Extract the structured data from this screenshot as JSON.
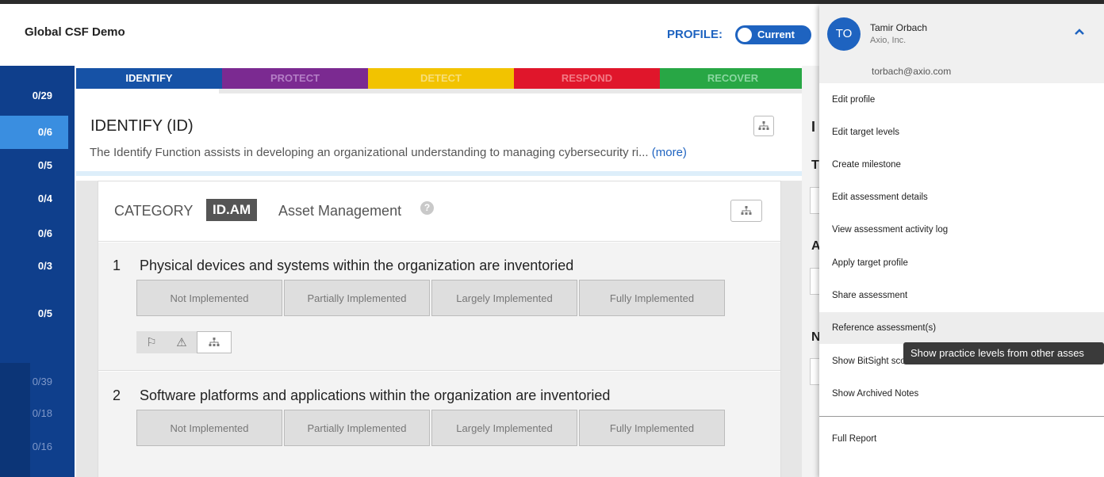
{
  "app": {
    "title": "Global CSF Demo"
  },
  "profile": {
    "label": "PROFILE:",
    "toggle": "Current"
  },
  "tabs": [
    {
      "label": "IDENTIFY",
      "color": "#1652a6"
    },
    {
      "label": "PROTECT",
      "color": "#7b2a91"
    },
    {
      "label": "DETECT",
      "color": "#f2c300"
    },
    {
      "label": "RESPOND",
      "color": "#e0162b"
    },
    {
      "label": "RECOVER",
      "color": "#28a745"
    }
  ],
  "sidebar": {
    "items": [
      "0/29",
      "0/6",
      "0/5",
      "0/4",
      "0/6",
      "0/3",
      "0/5"
    ],
    "dim_items": [
      "0/39",
      "0/18",
      "0/16"
    ]
  },
  "function": {
    "title": "IDENTIFY (ID)",
    "description": "The Identify Function assists in developing an organizational understanding to managing cybersecurity ri...",
    "more": "(more)"
  },
  "category": {
    "label": "CATEGORY",
    "code": "ID.AM",
    "name": "Asset Management"
  },
  "practices": [
    {
      "number": "1",
      "text": "Physical devices and systems within the organization are inventoried"
    },
    {
      "number": "2",
      "text": "Software platforms and applications within the organization are inventoried"
    }
  ],
  "levels": [
    "Not Implemented",
    "Partially Implemented",
    "Largely Implemented",
    "Fully Implemented"
  ],
  "right_panel": {
    "letters": [
      "I",
      "T",
      "A",
      "N"
    ]
  },
  "user": {
    "initials": "TO",
    "name": "Tamir Orbach",
    "org": "Axio, Inc.",
    "email": "torbach@axio.com"
  },
  "menu": [
    "Edit profile",
    "Edit target levels",
    "Create milestone",
    "Edit assessment details",
    "View assessment activity log",
    "Apply target profile",
    "Share assessment",
    "Reference assessment(s)",
    "Show BitSight scores",
    "Show Archived Notes",
    "Full Report"
  ],
  "tooltip": "Show practice levels from other asses",
  "icons": [
    "flag-icon",
    "warning-icon",
    "hierarchy-icon",
    "help-icon",
    "chevron-up-icon"
  ]
}
